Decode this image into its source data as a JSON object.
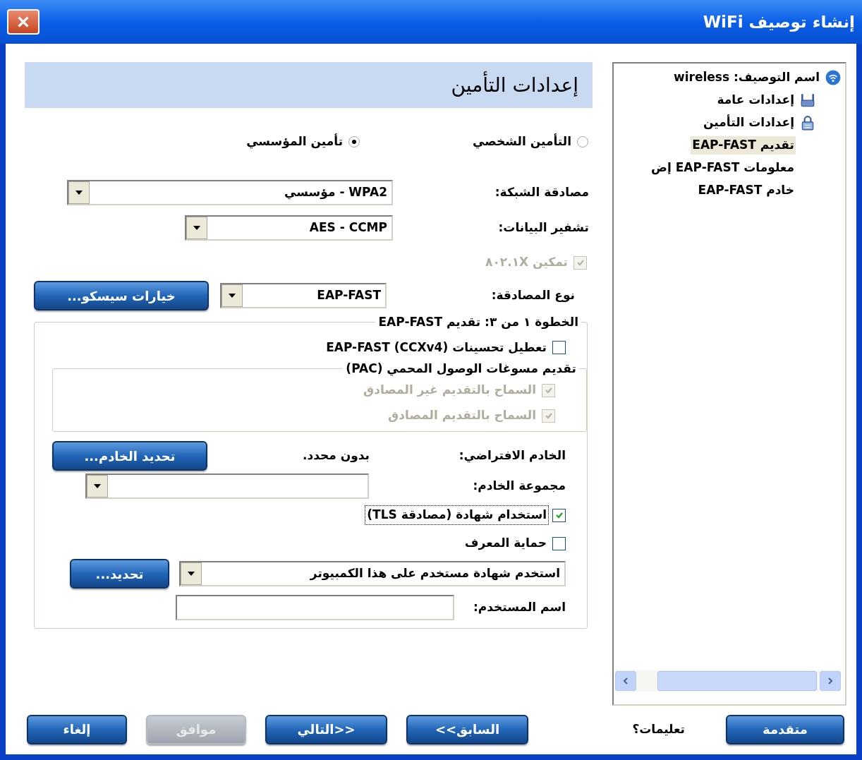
{
  "window": {
    "title": "إنشاء توصيف WiFi"
  },
  "section_title": "إعدادات التأمين",
  "security_modes": [
    {
      "label": "التأمين الشخصي",
      "selected": false
    },
    {
      "label": "تأمين المؤسسي",
      "selected": true
    }
  ],
  "network_auth": {
    "label": "مصادقة الشبكة:",
    "value": "WPA2 - مؤسسي"
  },
  "data_encryption": {
    "label": "تشفير البيانات:",
    "value": "AES - CCMP"
  },
  "enable_8021x": {
    "label": "تمكين ٨٠٢.١X",
    "checked": true,
    "disabled": true
  },
  "auth_type": {
    "label": "نوع المصادقة:",
    "value": "EAP-FAST",
    "button": "خيارات سيسكو..."
  },
  "step_group": {
    "legend": "الخطوة ١ من ٣: تقديم EAP-FAST",
    "disable_enhancements": {
      "label": "تعطيل تحسينات EAP-FAST (CCXv4)",
      "checked": false,
      "disabled": false
    },
    "pac_group": {
      "legend": "تقديم مسوغات الوصول المحمي (PAC)",
      "options": [
        {
          "label": "السماح بالتقديم غير المصادق",
          "checked": true,
          "disabled": true
        },
        {
          "label": "السماح بالتقديم المصادق",
          "checked": true,
          "disabled": true
        }
      ]
    },
    "default_server": {
      "label": "الخادم الافتراضي:",
      "value": "بدون محدد.",
      "button": "تحديد الخادم..."
    },
    "server_group": {
      "label": "مجموعة الخادم:"
    },
    "use_certificate": {
      "label": "استخدام شهادة (مصادقة TLS)",
      "checked": true,
      "disabled": false,
      "focused": true
    },
    "identity_protection": {
      "label": "حماية المعرف",
      "checked": false,
      "disabled": false
    },
    "certificate": {
      "value": "استخدم شهادة مستخدم على هذا الكمبيوتر",
      "button": "تحديد..."
    },
    "username": {
      "label": "اسم المستخدم:"
    }
  },
  "tree": [
    {
      "label": "**اسم التوصيف:** wireless",
      "kind": "wifi",
      "selected": false,
      "children": [
        {
          "label": "إعدادات عامة",
          "kind": "router",
          "selected": false
        },
        {
          "label": "إعدادات التأمين",
          "kind": "lock",
          "selected": false,
          "children": [
            {
              "label": "تقديم EAP-FAST",
              "selected": true
            },
            {
              "label": "معلومات EAP-FAST إض",
              "selected": false
            },
            {
              "label": "خادم EAP-FAST",
              "selected": false
            }
          ]
        }
      ]
    }
  ],
  "footer": {
    "advanced": {
      "label": "متقدمة",
      "disabled": false
    },
    "help": "تعليمات؟",
    "buttons": [
      {
        "label": "<<السابق",
        "disabled": false
      },
      {
        "label": "التالي>>",
        "disabled": false
      },
      {
        "label": "موافق",
        "disabled": true
      },
      {
        "label": "إلغاء",
        "disabled": false
      }
    ]
  }
}
